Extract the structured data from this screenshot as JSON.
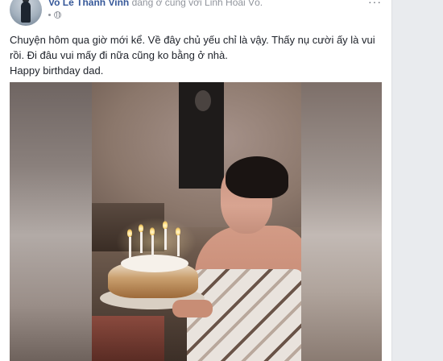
{
  "post": {
    "author": "Vo Le Thanh Vinh",
    "with_text": " đang ở cùng với Linh Hoài Võ.",
    "more_label": "···",
    "text_lines": [
      "Chuyện hôm qua giờ mới kể. Về đây chủ yếu chỉ là vậy. Thấy nụ cười ấy là vui",
      "rồi. Đi đâu vui mấy đi nữa cũng ko bằng ở nhà.",
      "Happy birthday dad."
    ]
  },
  "colors": {
    "author_link": "#365899",
    "meta_gray": "#90949c",
    "body_text": "#1d2129",
    "page_bg": "#e9ebee"
  },
  "icons": {
    "avatar": "profile-photo",
    "more": "more-options-icon",
    "privacy": "globe-icon"
  }
}
